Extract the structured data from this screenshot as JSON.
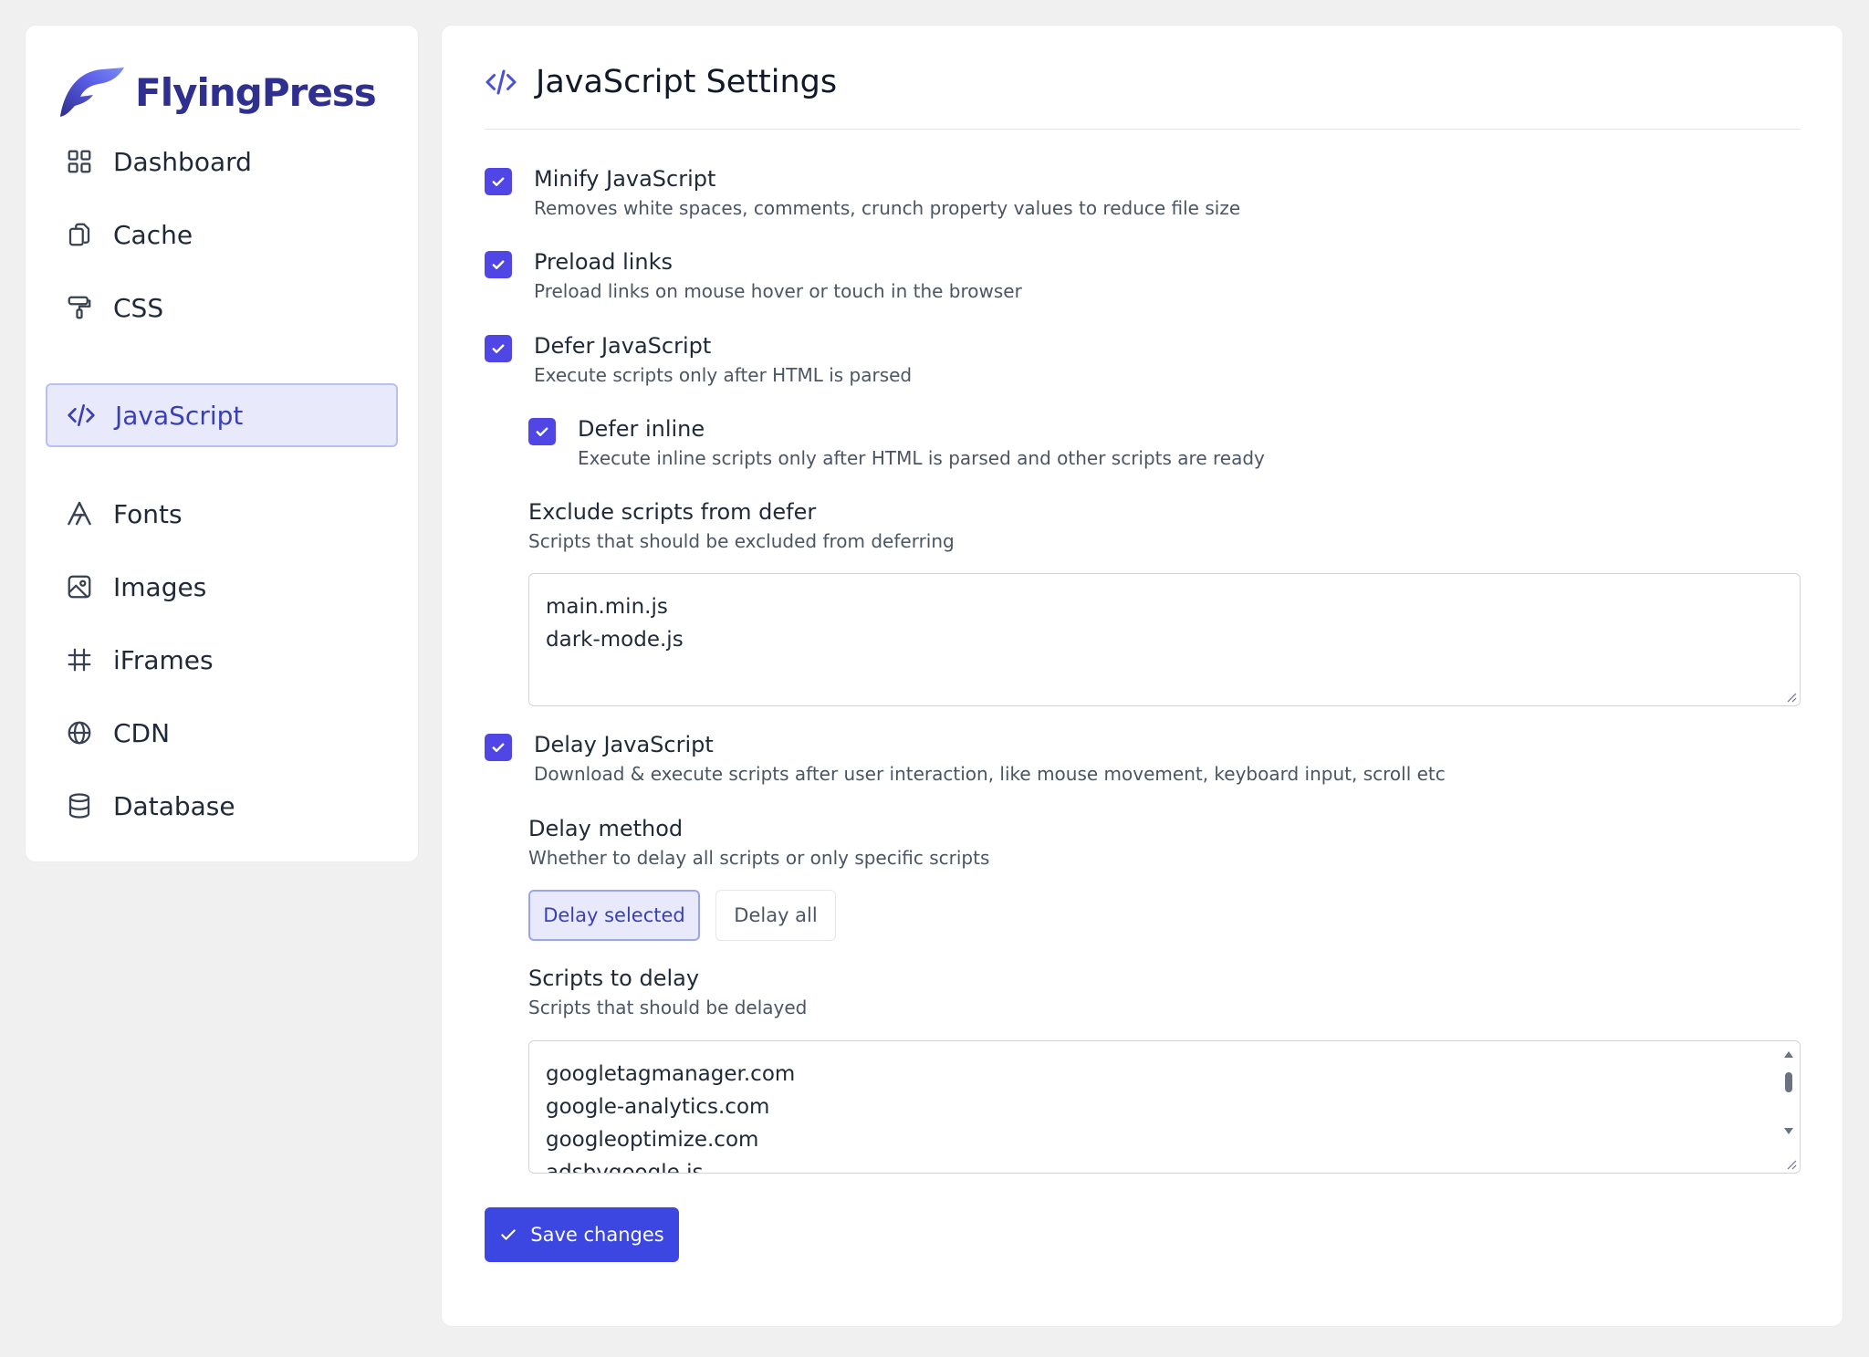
{
  "brand": {
    "name": "FlyingPress",
    "color": "#2e2f8e",
    "accent": "#4f46e5"
  },
  "sidebar": {
    "items": [
      {
        "label": "Dashboard",
        "icon": "grid-icon"
      },
      {
        "label": "Cache",
        "icon": "copy-icon"
      },
      {
        "label": "CSS",
        "icon": "paint-roller-icon"
      },
      {
        "label": "JavaScript",
        "icon": "code-icon",
        "active": true
      },
      {
        "label": "Fonts",
        "icon": "font-icon"
      },
      {
        "label": "Images",
        "icon": "image-icon"
      },
      {
        "label": "iFrames",
        "icon": "hash-icon"
      },
      {
        "label": "CDN",
        "icon": "globe-icon"
      },
      {
        "label": "Database",
        "icon": "database-icon"
      }
    ]
  },
  "main": {
    "title": "JavaScript Settings",
    "title_icon": "code-icon",
    "options": {
      "minify": {
        "label": "Minify JavaScript",
        "desc": "Removes white spaces, comments, crunch property values to reduce file size",
        "checked": true
      },
      "preload": {
        "label": "Preload links",
        "desc": "Preload links on mouse hover or touch in the browser",
        "checked": true
      },
      "defer": {
        "label": "Defer JavaScript",
        "desc": "Execute scripts only after HTML is parsed",
        "checked": true
      },
      "defer_inline": {
        "label": "Defer inline",
        "desc": "Execute inline scripts only after HTML is parsed and other scripts are ready",
        "checked": true
      },
      "delay": {
        "label": "Delay JavaScript",
        "desc": "Download & execute scripts after user interaction, like mouse movement, keyboard input, scroll etc",
        "checked": true
      }
    },
    "exclude_defer": {
      "label": "Exclude scripts from defer",
      "desc": "Scripts that should be excluded from deferring",
      "lines": [
        "main.min.js",
        "dark-mode.js"
      ]
    },
    "delay_method": {
      "label": "Delay method",
      "desc": "Whether to delay all scripts or only specific scripts",
      "options": [
        "Delay selected",
        "Delay all"
      ],
      "selected": "Delay selected"
    },
    "scripts_to_delay": {
      "label": "Scripts to delay",
      "desc": "Scripts that should be delayed",
      "lines": [
        "googletagmanager.com",
        "google-analytics.com",
        "googleoptimize.com",
        "adsbygoogle.js"
      ]
    },
    "save_label": "Save changes"
  }
}
